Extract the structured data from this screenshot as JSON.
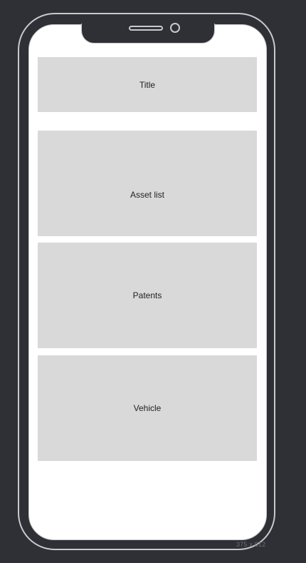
{
  "device": {
    "size_label": "375 x 812"
  },
  "sections": {
    "title": "Title",
    "asset_list": "Asset list",
    "patents": "Patents",
    "vehicle": "Vehicle"
  },
  "colors": {
    "background": "#2e3035",
    "frame_stroke": "#c9c9cc",
    "screen": "#ffffff",
    "placeholder_block": "#d9d9d9"
  }
}
